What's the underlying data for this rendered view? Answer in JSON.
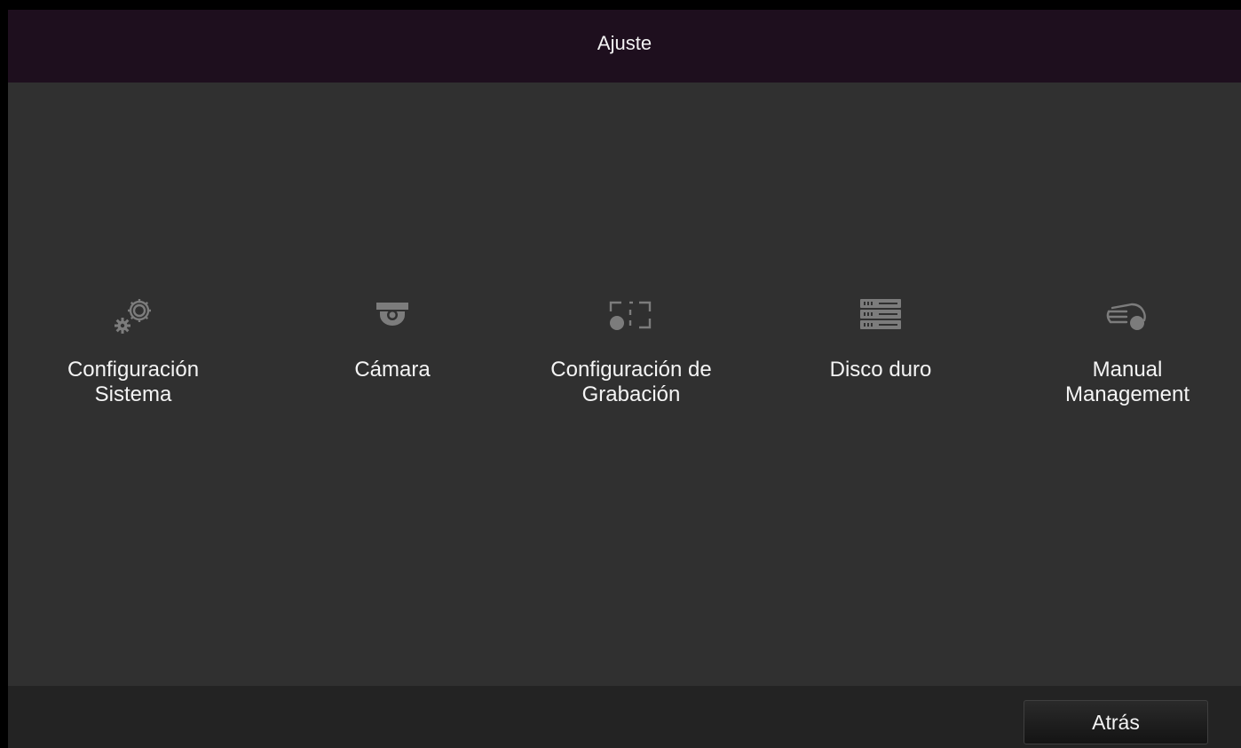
{
  "header": {
    "title": "Ajuste"
  },
  "menu": {
    "items": [
      {
        "icon": "gears-icon",
        "label_line1": "Configuración",
        "label_line2": "Sistema"
      },
      {
        "icon": "dome-camera-icon",
        "label_line1": "Cámara",
        "label_line2": ""
      },
      {
        "icon": "record-schedule-icon",
        "label_line1": "Configuración de",
        "label_line2": "Grabación"
      },
      {
        "icon": "hard-disk-icon",
        "label_line1": "Disco duro",
        "label_line2": ""
      },
      {
        "icon": "manual-record-icon",
        "label_line1": "Manual",
        "label_line2": "Management"
      }
    ]
  },
  "footer": {
    "back_label": "Atrás"
  },
  "colors": {
    "titlebar_bg": "#1e0f1e",
    "content_bg": "#303030",
    "footer_bg": "#232323",
    "icon": "#7c7c7c",
    "text": "#f4f4f4"
  }
}
